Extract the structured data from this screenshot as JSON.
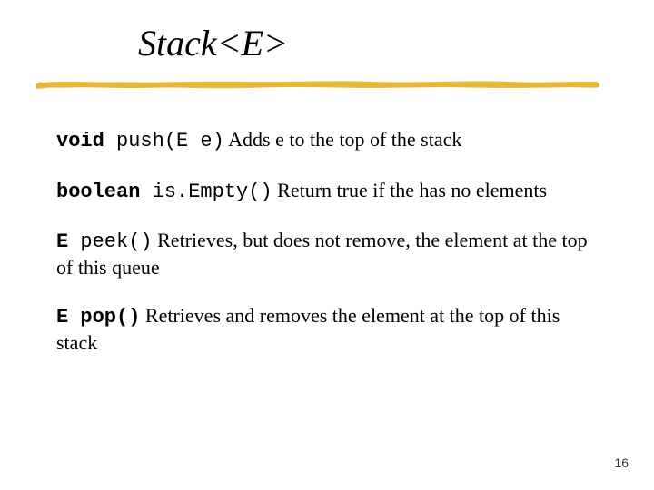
{
  "title": "Stack<E>",
  "entries": [
    {
      "keyword": "void",
      "signature": " push(E e)",
      "description": " Adds e to the top of the stack"
    },
    {
      "keyword": "boolean",
      "signature": " is.Empty()",
      "description": " Return true if the has no elements"
    },
    {
      "keyword": "E",
      "signature": " peek()",
      "description": " Retrieves, but does not remove, the element at the top of this queue"
    },
    {
      "keyword": "E pop()",
      "signature": "",
      "description": " Retrieves and removes the element at the top of this stack"
    }
  ],
  "page_number": "16"
}
